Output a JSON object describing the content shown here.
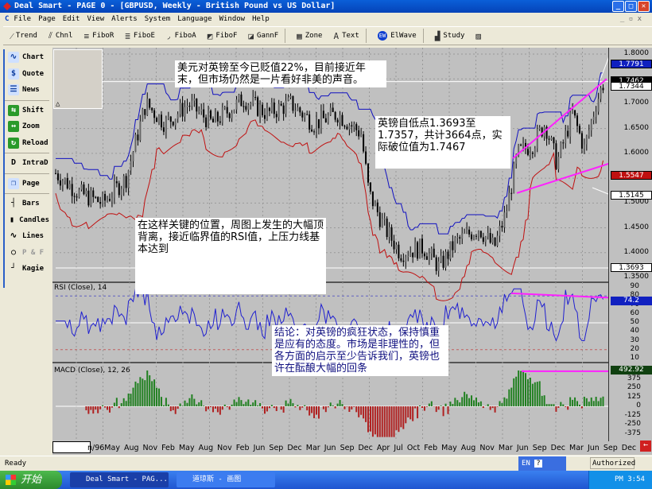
{
  "window": {
    "title": "Deal Smart - PAGE 0 - [GBPUSD, Weekly - British Pound vs US Dollar]"
  },
  "menu": [
    "File",
    "Page",
    "Edit",
    "View",
    "Alerts",
    "System",
    "Language",
    "Window",
    "Help"
  ],
  "toolbar": [
    {
      "icon": "trend-line-icon",
      "glyph": "⁄",
      "label": "Trend"
    },
    {
      "icon": "channel-icon",
      "glyph": "⫽",
      "label": "Chnl"
    },
    {
      "icon": "fibo-retracement-icon",
      "glyph": "≡",
      "label": "FiboR"
    },
    {
      "icon": "fibo-extension-icon",
      "glyph": "≣",
      "label": "FiboE"
    },
    {
      "icon": "fibo-arc-icon",
      "glyph": "◞",
      "label": "FiboA"
    },
    {
      "icon": "fibo-fan-icon",
      "glyph": "◩",
      "label": "FiboF"
    },
    {
      "icon": "gann-fan-icon",
      "glyph": "◪",
      "label": "GannF"
    },
    {
      "icon": "zone-icon",
      "glyph": "▦",
      "label": "Zone"
    },
    {
      "icon": "text-icon",
      "glyph": "A",
      "label": "Text"
    },
    {
      "icon": "elliott-wave-icon",
      "glyph": "EW",
      "label": "ElWave"
    },
    {
      "icon": "study-icon",
      "glyph": "▟",
      "label": "Study"
    }
  ],
  "sidebar": [
    {
      "label": "Chart",
      "icon": "chart-icon",
      "glyph": "∿"
    },
    {
      "label": "Quote",
      "icon": "quote-icon",
      "glyph": "$"
    },
    {
      "label": "News",
      "icon": "news-icon",
      "glyph": "☰"
    },
    {
      "sep": true
    },
    {
      "label": "Shift",
      "icon": "shift-icon",
      "glyph": "⇆"
    },
    {
      "label": "Zoom",
      "icon": "zoom-icon",
      "glyph": "↔"
    },
    {
      "label": "Reload",
      "icon": "reload-icon",
      "glyph": "↻"
    },
    {
      "sep": true
    },
    {
      "label": "IntraD",
      "icon": "intraday-icon",
      "glyph": "D"
    },
    {
      "sep": true
    },
    {
      "label": "Page",
      "icon": "page-icon",
      "glyph": "❐"
    },
    {
      "sep": true
    },
    {
      "label": "Bars",
      "icon": "bars-icon",
      "glyph": "┤"
    },
    {
      "label": "Candles",
      "icon": "candles-icon",
      "glyph": "▮"
    },
    {
      "label": "Lines",
      "icon": "lines-icon",
      "glyph": "∿"
    },
    {
      "label": "P & F",
      "icon": "point-figure-icon",
      "glyph": "○"
    },
    {
      "label": "Kagie",
      "icon": "kagi-icon",
      "glyph": "┘"
    }
  ],
  "price_axis": {
    "ticks": [
      "1.8000",
      "1.7000",
      "1.6500",
      "1.6000",
      "1.5000",
      "1.4500",
      "1.4000",
      "1.3500"
    ],
    "tags": [
      {
        "text": "1.7791",
        "price": 1.7791,
        "bg": "#1020c0",
        "fg": "#ffffff"
      },
      {
        "text": "1.7462",
        "price": 1.7462,
        "bg": "#000000",
        "fg": "#ffffff"
      },
      {
        "text": "1.7344",
        "price": 1.7344,
        "bg": "#ffffff",
        "fg": "#000000"
      },
      {
        "text": "1.5547",
        "price": 1.5547,
        "bg": "#c01010",
        "fg": "#ffffff"
      },
      {
        "text": "1.5145",
        "price": 1.5145,
        "bg": "#ffffff",
        "fg": "#000000"
      },
      {
        "text": "1.3693",
        "price": 1.3693,
        "bg": "#ffffff",
        "fg": "#000000"
      }
    ]
  },
  "rsi": {
    "title": "RSI (Close), 14",
    "ticks": [
      "90",
      "80",
      "70",
      "60",
      "50",
      "40",
      "30",
      "20",
      "10"
    ],
    "value_tag": "74.2",
    "levels": [
      80,
      50,
      20
    ]
  },
  "macd": {
    "title": "MACD (Close), 12, 26",
    "ticks": [
      "375",
      "250",
      "125",
      "0",
      "-125",
      "-250",
      "-375"
    ],
    "value_tag": "492.92"
  },
  "price_path": [
    [
      0,
      1.56
    ],
    [
      30,
      1.52
    ],
    [
      60,
      1.5
    ],
    [
      90,
      1.55
    ],
    [
      115,
      1.7
    ],
    [
      140,
      1.66
    ],
    [
      170,
      1.7
    ],
    [
      200,
      1.66
    ],
    [
      240,
      1.71
    ],
    [
      270,
      1.68
    ],
    [
      300,
      1.7
    ],
    [
      330,
      1.66
    ],
    [
      360,
      1.68
    ],
    [
      390,
      1.64
    ],
    [
      400,
      1.52
    ],
    [
      420,
      1.45
    ],
    [
      440,
      1.4
    ],
    [
      470,
      1.41
    ],
    [
      490,
      1.37
    ],
    [
      510,
      1.42
    ],
    [
      540,
      1.45
    ],
    [
      560,
      1.41
    ],
    [
      575,
      1.48
    ],
    [
      590,
      1.6
    ],
    [
      610,
      1.62
    ],
    [
      625,
      1.66
    ],
    [
      640,
      1.58
    ],
    [
      660,
      1.68
    ],
    [
      675,
      1.61
    ],
    [
      690,
      1.7
    ],
    [
      700,
      1.745
    ]
  ],
  "annotations": {
    "note1": "美元对英镑至今已贬值22%，目前接近年末，但市场仍然是一片看好非美的声音。",
    "note2": "英镑自低点1.3693至1.7357，共计3664点，实际破位值为1.7467",
    "note3": "在这样关键的位置，周图上发生的大幅顶背离，接近临界值的RSI值，上压力线基本达到",
    "note4": "结论：对英镑的疯狂状态，保持慎重是应有的态度。市场是非理性的，但各方面的启示至少告诉我们，英镑也许在酝酿大幅的回条"
  },
  "date_axis": "n/96May Aug Nov Feb May Aug Nov Feb  Jun Sep Dec Mar Jun Sep Dec  Apr Jul  Oct  Feb May Aug Nov  Mar Jun Sep Dec Mar Jun  Sep Dec",
  "status": {
    "text": "Ready",
    "lang": "EN",
    "right": "Authorized"
  },
  "taskbar": {
    "start": "开始",
    "tasks": [
      "Deal Smart - PAG...",
      "道琼斯 - 画图"
    ],
    "clock": "PM 3:54"
  },
  "colors": {
    "price": "#000000",
    "upper_band": "#1010c0",
    "lower_band": "#c01010",
    "trendline": "#ff20ff",
    "rsi": "#2020d0"
  }
}
